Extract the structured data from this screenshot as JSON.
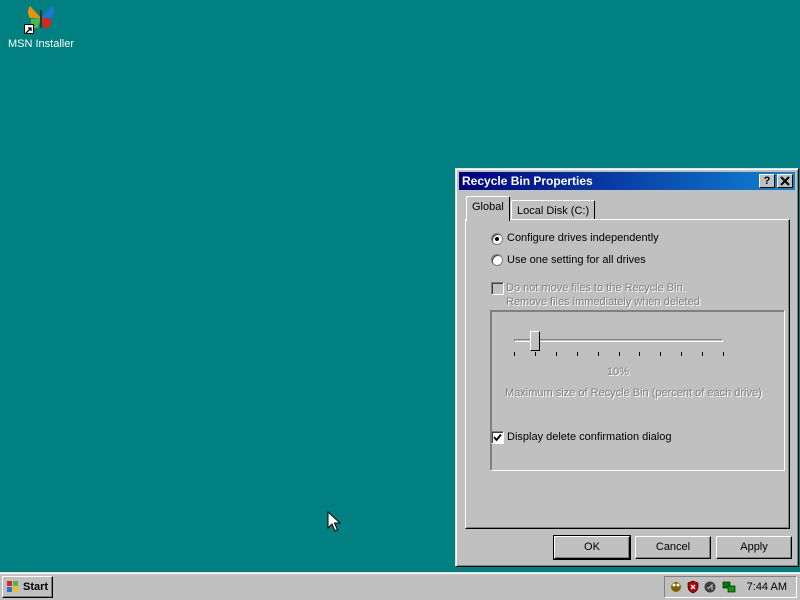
{
  "desktop": {
    "background": "#008080",
    "icons": [
      {
        "label": "MSN Installer",
        "icon": "msn-butterfly-icon"
      }
    ]
  },
  "window": {
    "title": "Recycle Bin Properties",
    "title_buttons": {
      "help": "?",
      "close": "✕"
    },
    "tabs": [
      {
        "label": "Global",
        "active": true
      },
      {
        "label": "Local Disk (C:)",
        "active": false
      }
    ],
    "options": {
      "radio_independent": {
        "label": "Configure drives independently",
        "selected": true
      },
      "radio_one_setting": {
        "label": "Use one setting for all drives",
        "selected": false
      }
    },
    "group": {
      "checkbox_no_move": {
        "line1": "Do not move files to the Recycle Bin.",
        "line2": "Remove files immediately when deleted",
        "checked": false,
        "disabled": true
      },
      "slider": {
        "value_label": "10%",
        "value_percent": 10,
        "caption": "Maximum size of Recycle Bin (percent of each drive)",
        "disabled": true
      }
    },
    "confirm_checkbox": {
      "label": "Display delete confirmation dialog",
      "checked": true
    },
    "buttons": {
      "ok": "OK",
      "cancel": "Cancel",
      "apply": "Apply"
    }
  },
  "taskbar": {
    "start_label": "Start",
    "tray_icons": [
      "agent-icon",
      "shield-icon",
      "sound-icon",
      "network-icon"
    ],
    "clock": "7:44 AM"
  },
  "colors": {
    "title_start": "#000080",
    "title_end": "#1084d0",
    "face": "#c0c0c0"
  }
}
